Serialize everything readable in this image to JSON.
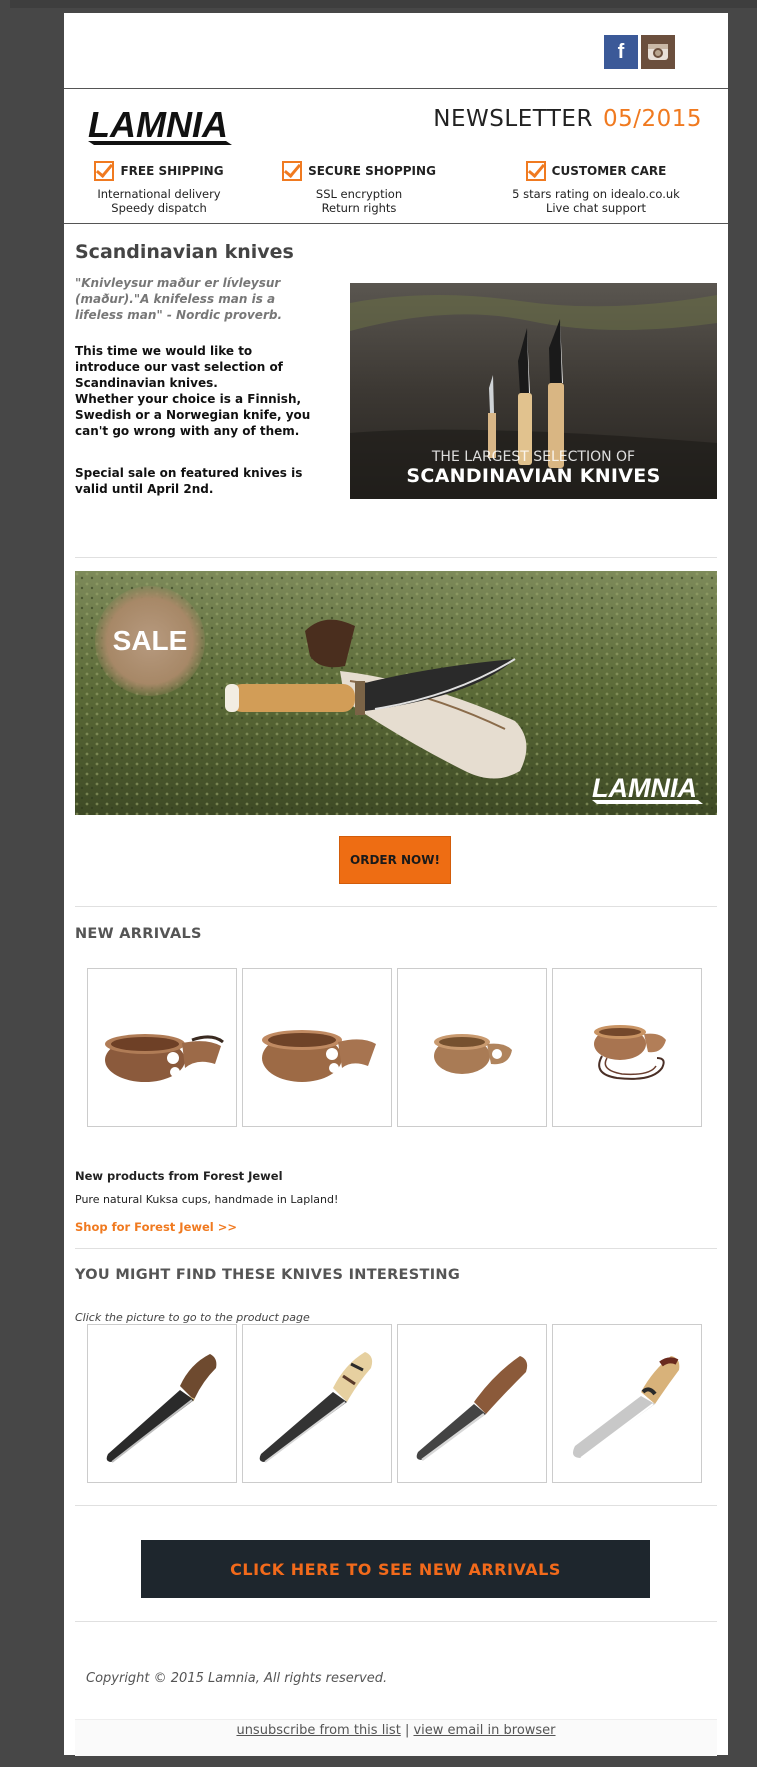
{
  "header": {
    "social": [
      {
        "icon": "facebook-icon",
        "glyph": "f"
      },
      {
        "icon": "instagram-icon",
        "glyph": "◘"
      }
    ],
    "logo_text": "LAMNIA",
    "newsletter_label": "NEWSLETTER",
    "issue": "05/2015"
  },
  "features": [
    {
      "title": "FREE SHIPPING",
      "line1": "International delivery",
      "line2": "Speedy dispatch"
    },
    {
      "title": "SECURE SHOPPING",
      "line1": "SSL encryption",
      "line2": "Return rights"
    },
    {
      "title": "CUSTOMER CARE",
      "line1": "5 stars rating on idealo.co.uk",
      "line2": "Live chat support"
    }
  ],
  "intro": {
    "title": "Scandinavian knives",
    "proverb": "\"Knivleysur maður er lívleysur (maður).\"A knifeless man is a lifeless man\" - Nordic proverb.",
    "body1": "This time we would like to introduce our vast selection of Scandinavian knives.",
    "body2": "Whether your choice is a Finnish, Swedish or a Norwegian knife, you can't go wrong with any of them.",
    "sale_note": "Special sale on featured knives is valid until April 2nd.",
    "image_caption_1": "THE LARGEST SELECTION OF",
    "image_caption_2": "SCANDINAVIAN KNIVES"
  },
  "banner": {
    "sale_text": "SALE",
    "logo_text": "LAMNIA",
    "order_button": "ORDER NOW!"
  },
  "new_arrivals": {
    "title": "NEW ARRIVALS",
    "products_title": "New products from Forest Jewel",
    "description": "Pure natural Kuksa cups, handmade in Lapland!",
    "link": "Shop for Forest Jewel >>"
  },
  "knives_section": {
    "title": "YOU MIGHT FIND THESE KNIVES INTERESTING",
    "hint": "Click the picture to go to the product page"
  },
  "cta": "CLICK HERE TO SEE NEW ARRIVALS",
  "footer": {
    "copyright": "Copyright © 2015 Lamnia, All rights reserved.",
    "unsubscribe": "unsubscribe from this list",
    "separator": "|",
    "view_browser": "view email in browser"
  },
  "colors": {
    "accent": "#f07a20",
    "cta_bg": "#1e262d",
    "frame": "#474747"
  }
}
